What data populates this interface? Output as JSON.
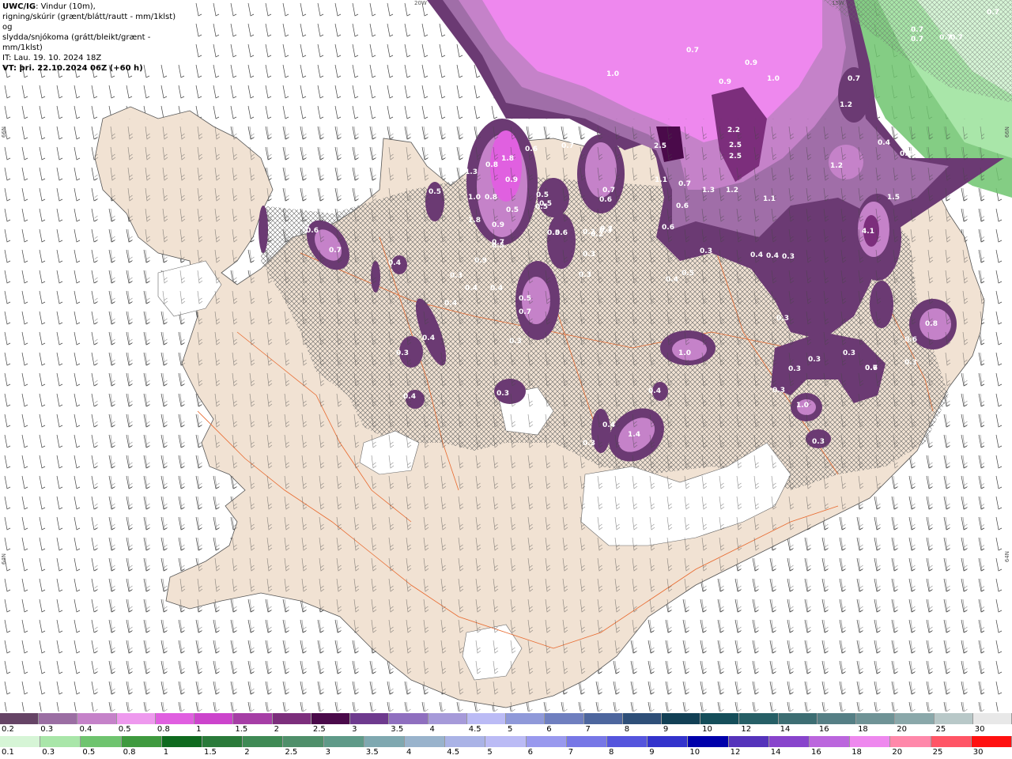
{
  "header": {
    "model": "UWC/IG",
    "line1_rest": ": Vindur (10m),",
    "line2": "rigning/skúrir (grænt/blátt/rautt - mm/1klst) og",
    "line3": "slydda/snjókoma (grátt/bleikt/grænt - mm/1klst)",
    "line4": "IT: Lau. 19. 10. 2024 18Z",
    "line5": "VT: þri. 22.10.2024 06Z (+60 h)"
  },
  "coords": {
    "top_left": "20W",
    "top_right": "15W",
    "left_upper": "66N",
    "left_lower": "64N",
    "right_upper": "66N",
    "right_lower": "64N"
  },
  "colors": {
    "land": "#f1e2d3",
    "glacier": "#ffffff",
    "roads": "#e8692e",
    "hatch": "#555555",
    "snow_light": "#c27fc2",
    "snow_mid": "#e060e0",
    "snow_strong": "#f080f0",
    "snow_dark": "#6b3a73",
    "green_rain": "#4a9e5c"
  },
  "legend_top": {
    "labels": [
      "0.2",
      "0.3",
      "0.4",
      "0.5",
      "0.8",
      "1",
      "1.5",
      "2",
      "2.5",
      "3",
      "3.5",
      "4",
      "4.5",
      "5",
      "6",
      "7",
      "8",
      "9",
      "10",
      "12",
      "14",
      "16",
      "18",
      "20",
      "25",
      "30"
    ],
    "colors": [
      "#664466",
      "#9b6ea3",
      "#c582c9",
      "#ee99ee",
      "#e05fe0",
      "#cc44cc",
      "#a63ea6",
      "#7c2e7c",
      "#4a0a4a",
      "#6e3a8e",
      "#8f6fbf",
      "#a69ad9",
      "#bbbbf5",
      "#8f99d9",
      "#6f7fbf",
      "#4d669e",
      "#2e4f78",
      "#124055",
      "#154e5a",
      "#265f66",
      "#3d6e73",
      "#557f85",
      "#6f9396",
      "#8aa8aa",
      "#b8c8c8",
      "#e8e8e8"
    ]
  },
  "legend_bottom": {
    "labels": [
      "0.1",
      "0.3",
      "0.5",
      "0.8",
      "1",
      "1.5",
      "2",
      "2.5",
      "3",
      "3.5",
      "4",
      "4.5",
      "5",
      "6",
      "7",
      "8",
      "9",
      "10",
      "12",
      "14",
      "16",
      "18",
      "20",
      "25",
      "30"
    ],
    "colors": [
      "#d6f5d6",
      "#a9e6a9",
      "#6fc46f",
      "#3f9a3f",
      "#0f6a1f",
      "#2a7a3a",
      "#3f8a55",
      "#4f8f6a",
      "#5f9a88",
      "#7fa8b0",
      "#99b3cc",
      "#aab3e6",
      "#bbbbf5",
      "#9999ee",
      "#7777e6",
      "#5555dd",
      "#3333cc",
      "#0000aa",
      "#5533bb",
      "#8844cc",
      "#bb66dd",
      "#ee88ee",
      "#ff88aa",
      "#ff5566",
      "#ff1111"
    ]
  },
  "map_labels": [
    {
      "text": "0.7"
    },
    {
      "text": "0.7"
    },
    {
      "text": "0.7"
    },
    {
      "text": "0.7"
    },
    {
      "text": "0.7"
    },
    {
      "text": "1.0"
    },
    {
      "text": "0.7"
    },
    {
      "text": "0.9"
    },
    {
      "text": "1.0"
    },
    {
      "text": "0.9"
    },
    {
      "text": "0.7"
    },
    {
      "text": "1.2"
    },
    {
      "text": "2.5"
    },
    {
      "text": "2.2"
    },
    {
      "text": "2.5"
    },
    {
      "text": "2.5"
    },
    {
      "text": "0.4"
    },
    {
      "text": "0.4"
    },
    {
      "text": "1.2"
    },
    {
      "text": "1.1"
    },
    {
      "text": "0.7"
    },
    {
      "text": "1.3"
    },
    {
      "text": "1.2"
    },
    {
      "text": "1.1"
    },
    {
      "text": "1.5"
    },
    {
      "text": "0.6"
    },
    {
      "text": "4.1"
    },
    {
      "text": "0.6"
    },
    {
      "text": "0.3"
    },
    {
      "text": "0.4"
    },
    {
      "text": "0.4"
    },
    {
      "text": "0.3"
    },
    {
      "text": "0.5"
    },
    {
      "text": "0.4"
    },
    {
      "text": "0.3"
    },
    {
      "text": "0.8"
    },
    {
      "text": "0.6"
    },
    {
      "text": "0.3"
    },
    {
      "text": "1.0"
    },
    {
      "text": "0.3"
    },
    {
      "text": "0.3"
    },
    {
      "text": "0.3"
    },
    {
      "text": "0.7"
    },
    {
      "text": "0.3"
    },
    {
      "text": "1.0"
    },
    {
      "text": "0.3"
    },
    {
      "text": "0.4"
    },
    {
      "text": "1.4"
    },
    {
      "text": "0.2"
    },
    {
      "text": "0.3"
    },
    {
      "text": "0.7"
    },
    {
      "text": "0.6"
    },
    {
      "text": "1.8"
    },
    {
      "text": "0.8"
    },
    {
      "text": "1.3"
    },
    {
      "text": "0.9"
    },
    {
      "text": "1.0"
    },
    {
      "text": "0.8"
    },
    {
      "text": "0.5"
    },
    {
      "text": "0.5"
    },
    {
      "text": "0.5"
    },
    {
      "text": "1.8"
    },
    {
      "text": "0.9"
    },
    {
      "text": "0.7"
    },
    {
      "text": "0.9"
    },
    {
      "text": "0.4"
    },
    {
      "text": "0.4"
    },
    {
      "text": "0.5"
    },
    {
      "text": "0.5"
    },
    {
      "text": "0.3"
    },
    {
      "text": "0.3"
    },
    {
      "text": "0.3"
    },
    {
      "text": "0.4"
    },
    {
      "text": "0.4"
    },
    {
      "text": "0.6"
    },
    {
      "text": "0.7"
    },
    {
      "text": "0.4"
    },
    {
      "text": "0.3"
    },
    {
      "text": "0.4"
    },
    {
      "text": "0.3"
    },
    {
      "text": "0.3"
    },
    {
      "text": "0.4"
    },
    {
      "text": "0.6"
    },
    {
      "text": "0.5"
    },
    {
      "text": "0.7"
    },
    {
      "text": "0.5"
    },
    {
      "text": "0.6"
    },
    {
      "text": "0.5"
    },
    {
      "text": "0.7"
    },
    {
      "text": "0.6"
    },
    {
      "text": "0.2"
    },
    {
      "text": "0.3"
    },
    {
      "text": "0.3"
    }
  ]
}
